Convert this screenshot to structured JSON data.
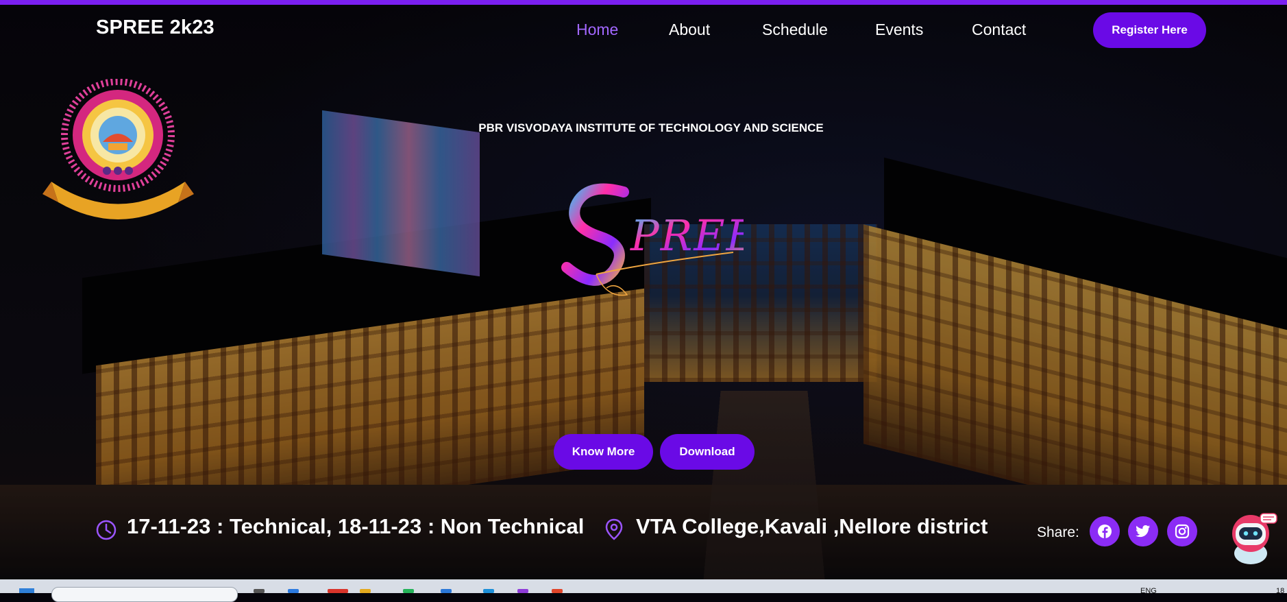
{
  "header": {
    "brand": "SPREE 2k23",
    "nav": [
      {
        "label": "Home",
        "active": true
      },
      {
        "label": "About",
        "active": false
      },
      {
        "label": "Schedule",
        "active": false
      },
      {
        "label": "Events",
        "active": false
      },
      {
        "label": "Contact",
        "active": false
      }
    ],
    "register_label": "Register Here"
  },
  "hero": {
    "institute": "PBR VISVODAYA INSTITUTE OF TECHNOLOGY AND SCIENCE",
    "logo_text": "Spree",
    "know_more_label": "Know More",
    "download_label": "Download"
  },
  "info": {
    "dates": "17-11-23 : Technical, 18-11-23 : Non Technical",
    "location": "VTA College,Kavali ,Nellore district",
    "share_label": "Share:",
    "social_icons": [
      "facebook-icon",
      "twitter-icon",
      "instagram-icon"
    ]
  },
  "taskbar": {
    "language": "ENG",
    "clock": "18"
  },
  "colors": {
    "accent": "#6a0ae6",
    "active_nav": "#a267ff",
    "social_bg": "#8b2cf5"
  }
}
